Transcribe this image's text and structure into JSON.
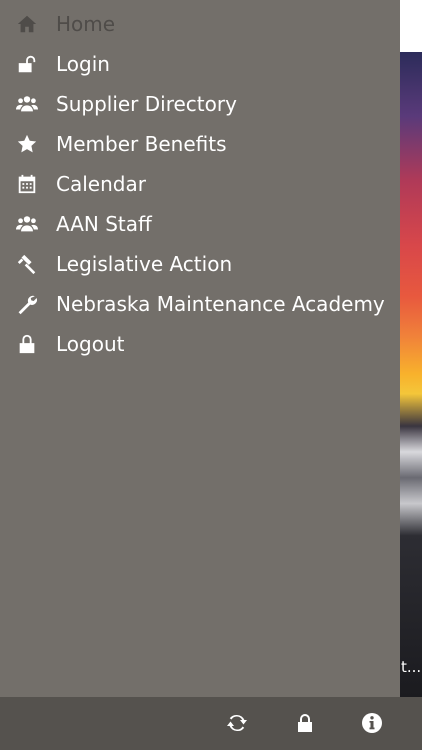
{
  "menu": {
    "items": [
      {
        "label": "Home",
        "icon": "home-icon"
      },
      {
        "label": "Login",
        "icon": "unlock-icon"
      },
      {
        "label": "Supplier Directory",
        "icon": "users-icon"
      },
      {
        "label": "Member Benefits",
        "icon": "star-icon"
      },
      {
        "label": "Calendar",
        "icon": "calendar-icon"
      },
      {
        "label": "AAN Staff",
        "icon": "users-icon"
      },
      {
        "label": "Legislative Action",
        "icon": "gavel-icon"
      },
      {
        "label": "Nebraska Maintenance Academy",
        "icon": "wrench-icon"
      },
      {
        "label": "Logout",
        "icon": "lock-icon"
      }
    ]
  },
  "background": {
    "snippet": "t..."
  },
  "bottom_bar": {
    "buttons": [
      {
        "icon": "refresh-icon"
      },
      {
        "icon": "lock-icon"
      },
      {
        "icon": "info-icon"
      }
    ]
  },
  "colors": {
    "drawer": "#736f6a",
    "bottom_bar": "#55524e",
    "text": "#ffffff",
    "active_dim": "#4f4c49"
  }
}
